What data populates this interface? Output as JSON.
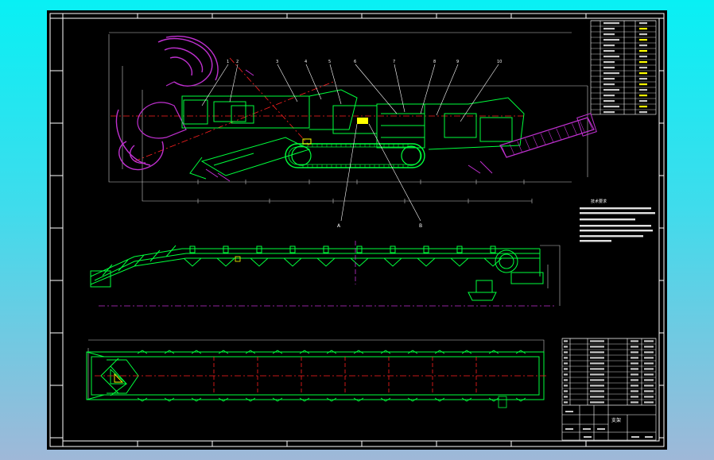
{
  "drawing": {
    "title_block_label": "支架",
    "section_labels": {
      "a": "A",
      "b": "B"
    },
    "callouts": [
      "1",
      "2",
      "3",
      "4",
      "5",
      "6",
      "7",
      "8",
      "9",
      "10"
    ],
    "notes_heading": "技术要求"
  },
  "colors": {
    "background": "#000000",
    "frame": "#ffffff",
    "structure": "#00ff3c",
    "hydraulic": "#c030d0",
    "centerline": "#ff2020",
    "dimension": "#c8c8c8",
    "highlight": "#ffff00"
  }
}
